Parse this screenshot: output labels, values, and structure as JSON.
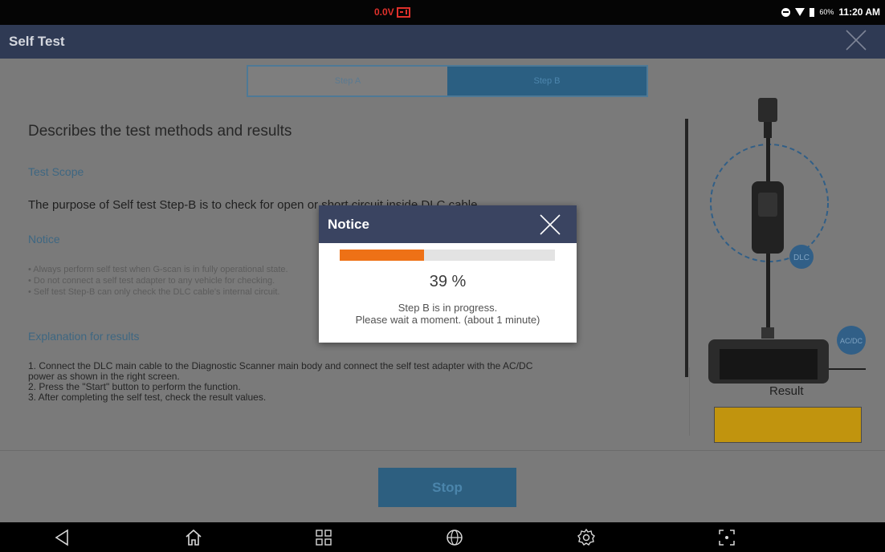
{
  "status_bar": {
    "voltage": "0.0V",
    "battery_percent": "60%",
    "time": "11:20 AM"
  },
  "header": {
    "title": "Self Test"
  },
  "tabs": [
    {
      "label": "Step A",
      "selected": false
    },
    {
      "label": "Step B",
      "selected": true
    }
  ],
  "content": {
    "heading": "Describes the test methods and results",
    "section_scope": "Test Scope",
    "scope_text": "The purpose of Self test Step-B is to check for open or short circuit inside DLC cable.",
    "section_notice": "Notice",
    "notice_items": [
      "• Always perform self test when G-scan is in fully operational state.",
      "• Do not connect a self test adapter to any vehicle for checking.",
      "• Self test Step-B can only check the DLC cable's internal circuit."
    ],
    "section_results": "Explanation for results",
    "result_steps": [
      "1. Connect the DLC main cable to the Diagnostic Scanner main body and connect the self test adapter with the AC/DC",
      "power as shown in the right screen.",
      "2. Press the \"Start\" button to perform the function.",
      "3. After completing the self test, check the result values."
    ]
  },
  "illustration": {
    "dlc_label": "DLC",
    "acdc_label": "AC/DC"
  },
  "result": {
    "label": "Result",
    "color": "#c1940e"
  },
  "footer": {
    "stop_label": "Stop"
  },
  "dialog": {
    "title": "Notice",
    "progress_fraction": 0.39,
    "progress_text": "39 %",
    "message_line1": "Step B is in progress.",
    "message_line2": "Please wait a moment. (about 1 minute)"
  },
  "navbar": {
    "icons": [
      "back-icon",
      "home-icon",
      "apps-icon",
      "browser-icon",
      "settings-icon",
      "screenshot-icon"
    ]
  },
  "colors": {
    "accent": "#2f3a54",
    "progress": "#ee7116",
    "link": "#3e6782"
  }
}
